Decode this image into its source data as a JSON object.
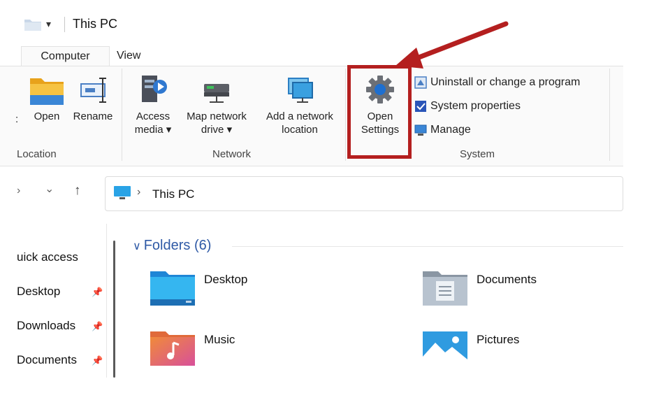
{
  "titlebar": {
    "title": "This PC",
    "dropdown_glyph": "▾"
  },
  "ribbon": {
    "tabs": [
      {
        "label": "Computer"
      },
      {
        "label": "View"
      }
    ],
    "location_group": {
      "label": "Location",
      "open_label": "Open",
      "rename_label": "Rename"
    },
    "network_group": {
      "label": "Network",
      "access_media_line1": "Access",
      "access_media_line2": "media ▾",
      "map_drive_line1": "Map network",
      "map_drive_line2": "drive ▾",
      "add_location_line1": "Add a network",
      "add_location_line2": "location"
    },
    "system_group": {
      "label": "System",
      "open_settings_line1": "Open",
      "open_settings_line2": "Settings",
      "items": [
        {
          "label": "Uninstall or change a program"
        },
        {
          "label": "System properties"
        },
        {
          "label": "Manage"
        }
      ]
    }
  },
  "nav": {
    "forward_glyph": "›",
    "recent_glyph": "⌄",
    "up_glyph": "↑",
    "address": "This PC",
    "address_chevron": "›"
  },
  "sidebar": {
    "items": [
      {
        "label": "uick access",
        "pinned": false
      },
      {
        "label": "Desktop",
        "pinned": true
      },
      {
        "label": "Downloads",
        "pinned": true
      },
      {
        "label": "Documents",
        "pinned": true
      }
    ],
    "pin_glyph": "📌"
  },
  "content": {
    "section_title": "Folders (6)",
    "section_chevron": "∨",
    "folders": [
      {
        "label": "Desktop"
      },
      {
        "label": "Documents"
      },
      {
        "label": "Music"
      },
      {
        "label": "Pictures"
      }
    ]
  },
  "colors": {
    "highlight_red": "#b41f1f",
    "accent_blue": "#2f5aa6",
    "folder_yellow": "#f6c343"
  }
}
